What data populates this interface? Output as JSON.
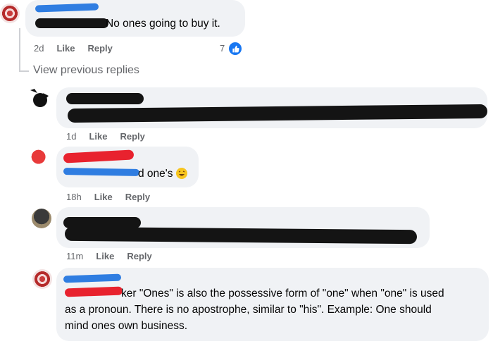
{
  "comments": [
    {
      "text": "No ones going to buy it.",
      "time": "2d",
      "like": "Like",
      "reply": "Reply",
      "reaction_count": "7"
    },
    {
      "time": "1d",
      "like": "Like",
      "reply": "Reply"
    },
    {
      "text": "d one's",
      "time": "18h",
      "like": "Like",
      "reply": "Reply"
    },
    {
      "time": "11m",
      "like": "Like",
      "reply": "Reply"
    },
    {
      "text_line1": "ker \"Ones\" is also the possessive form of \"one\" when \"one\" is used",
      "text_line2": "as a pronoun. There is no apostrophe, similar to \"his\". Example: One should",
      "text_line3": "mind ones own business."
    }
  ],
  "view_previous": "View previous replies",
  "icons": {
    "like_reaction": "thumbs-up-icon",
    "laugh_emoji": "laughing-emoji-icon"
  },
  "colors": {
    "bubble": "#f0f2f5",
    "meta": "#65676b",
    "like_blue": "#1877f2"
  }
}
